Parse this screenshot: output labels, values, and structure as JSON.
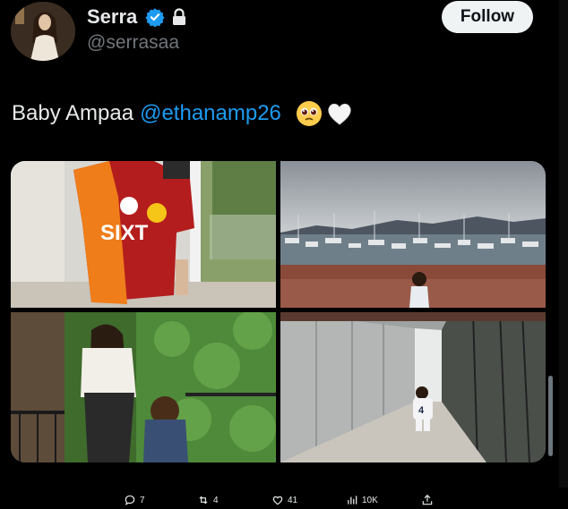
{
  "author": {
    "display_name": "Serra",
    "handle": "@serrasaa",
    "verified_icon": "verified-badge-icon",
    "protected_icon": "lock-icon"
  },
  "follow_button": {
    "label": "Follow"
  },
  "tweet": {
    "text": "Baby Ampaa",
    "mention": "@ethanamp26",
    "emojis": [
      "pleading-face-emoji",
      "white-heart-emoji"
    ]
  },
  "media": [
    {
      "id": "photo-jersey",
      "jersey_sponsor": "SIXT"
    },
    {
      "id": "photo-harbor"
    },
    {
      "id": "photo-garden"
    },
    {
      "id": "photo-walkway",
      "shirt_number": "4"
    }
  ],
  "actions": {
    "replies": "7",
    "reposts": "4",
    "likes": "41",
    "views": "10K"
  },
  "colors": {
    "background": "#000000",
    "text": "#e7e9ea",
    "secondary_text": "#71767b",
    "link": "#1d9bf0",
    "follow_bg": "#eff3f4"
  }
}
